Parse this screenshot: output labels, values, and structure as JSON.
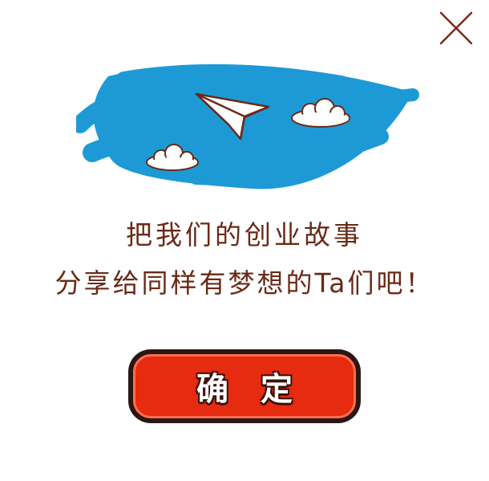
{
  "dialog": {
    "line1": "把我们的创业故事",
    "line2": "分享给同样有梦想的Ta们吧！",
    "confirm_label": "确定"
  },
  "icons": {
    "close": "close-icon",
    "plane": "paper-plane-icon",
    "cloud": "cloud-icon"
  },
  "colors": {
    "sky": "#1d9ad6",
    "text": "#6a2a17",
    "button": "#e62b10",
    "button_border": "#2a1713",
    "close": "#7a2a1c"
  }
}
